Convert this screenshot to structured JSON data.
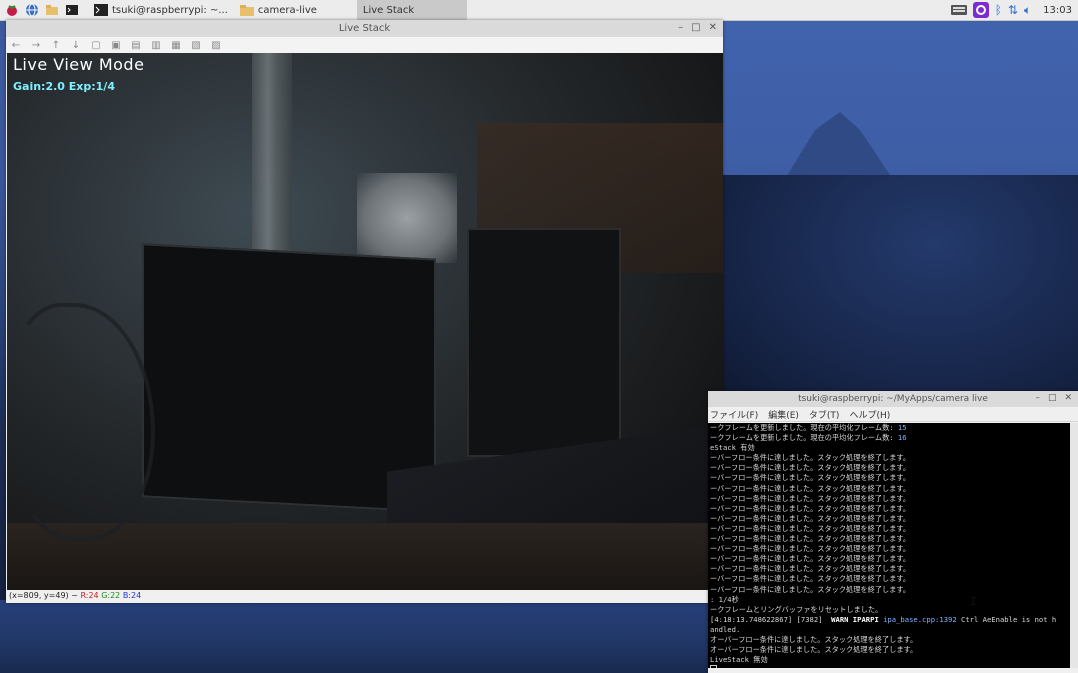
{
  "panel": {
    "tasks": [
      {
        "label": "tsuki@raspberrypi: ~...",
        "kind": "terminal"
      },
      {
        "label": "camera-live",
        "kind": "folder"
      },
      {
        "label": "Live Stack",
        "kind": "window"
      }
    ],
    "clock": "13:03"
  },
  "livestack": {
    "title": "Live Stack",
    "overlay_title": "Live View Mode",
    "overlay_sub": "Gain:2.0 Exp:1/4",
    "status_prefix": "(x=809, y=49) ~ ",
    "status_r": "R:24",
    "status_g": "G:22",
    "status_b": "B:24"
  },
  "terminal": {
    "title": "tsuki@raspberrypi: ~/MyApps/camera live",
    "menu": [
      "ファイル(F)",
      "編集(E)",
      "タブ(T)",
      "ヘルプ(H)"
    ],
    "lines": [
      {
        "text": "ークフレームを更新しました。現在の平均化フレーム数: ",
        "num": "15"
      },
      {
        "text": "ークフレームを更新しました。現在の平均化フレーム数: ",
        "num": "16"
      },
      {
        "text": "eStack 有効"
      },
      {
        "text": "ーバーフロー条件に達しました。スタック処理を終了します。"
      },
      {
        "text": "ーバーフロー条件に達しました。スタック処理を終了します。"
      },
      {
        "text": "ーバーフロー条件に達しました。スタック処理を終了します。"
      },
      {
        "text": "ーバーフロー条件に達しました。スタック処理を終了します。"
      },
      {
        "text": "ーバーフロー条件に達しました。スタック処理を終了します。"
      },
      {
        "text": "ーバーフロー条件に達しました。スタック処理を終了します。"
      },
      {
        "text": "ーバーフロー条件に達しました。スタック処理を終了します。"
      },
      {
        "text": "ーバーフロー条件に達しました。スタック処理を終了します。"
      },
      {
        "text": "ーバーフロー条件に達しました。スタック処理を終了します。"
      },
      {
        "text": "ーバーフロー条件に達しました。スタック処理を終了します。"
      },
      {
        "text": "ーバーフロー条件に達しました。スタック処理を終了します。"
      },
      {
        "text": "ーバーフロー条件に達しました。スタック処理を終了します。"
      },
      {
        "text": "ーバーフロー条件に達しました。スタック処理を終了します。"
      },
      {
        "text": "ーバーフロー条件に達しました。スタック処理を終了します。"
      },
      {
        "text": ": 1/4秒"
      },
      {
        "text": "ークフレームとリングバッファをリセットしました。"
      }
    ],
    "warn_prefix": "[4:18:13.748622867] [7382]  ",
    "warn_tag": "WARN IPARPI ",
    "warn_src": "ipa_base.cpp:1392",
    "warn_msg": " Ctrl AeEnable is not h",
    "warn_cont": "andled.",
    "after": [
      "オーバーフロー条件に達しました。スタック処理を終了します。",
      "オーバーフロー条件に達しました。スタック処理を終了します。",
      "LiveStack 無効"
    ]
  }
}
